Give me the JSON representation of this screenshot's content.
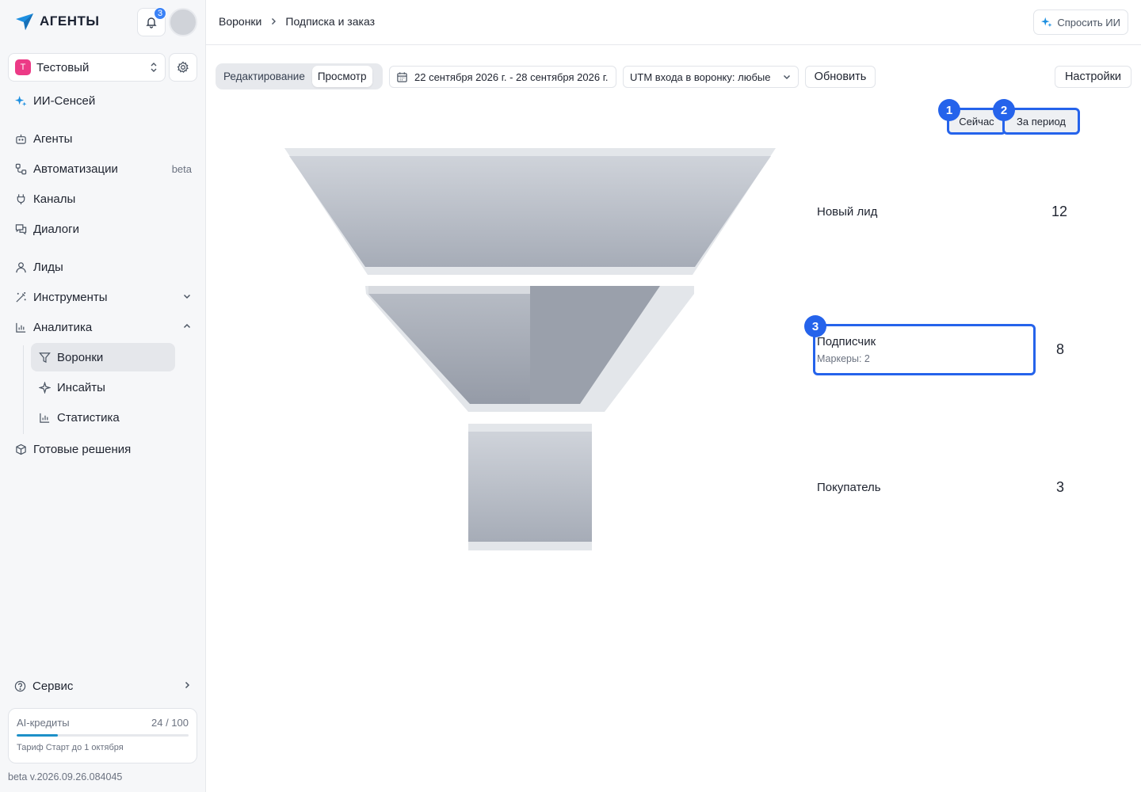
{
  "app": {
    "logo_text": "АГЕНТЫ",
    "notification_count": "3"
  },
  "workspace": {
    "badge": "Т",
    "name": "Тестовый"
  },
  "nav": {
    "ai_sensei": "ИИ-Сенсей",
    "agents": "Агенты",
    "automations": "Автоматизации",
    "automations_badge": "beta",
    "channels": "Каналы",
    "dialogs": "Диалоги",
    "leads": "Лиды",
    "tools": "Инструменты",
    "analytics": "Аналитика",
    "funnels": "Воронки",
    "insights": "Инсайты",
    "statistics": "Статистика",
    "solutions": "Готовые решения",
    "service": "Сервис"
  },
  "credits": {
    "label": "AI-кредиты",
    "value": "24 / 100",
    "used_fraction": 0.24,
    "plan": "Тариф Старт до 1 октября"
  },
  "version": "beta v.2026.09.26.084045",
  "breadcrumb": {
    "root": "Воронки",
    "current": "Подписка и заказ"
  },
  "ask_ai": "Спросить ИИ",
  "toolbar": {
    "edit": "Редактирование",
    "view": "Просмотр",
    "date_range": "22 сентября 2026 г. - 28 сентября 2026 г.",
    "utm": "UTM входа в воронку: любые",
    "refresh": "Обновить",
    "settings": "Настройки"
  },
  "toggle": {
    "now": "Сейчас",
    "period": "За период"
  },
  "markers": {
    "m1": "1",
    "m2": "2",
    "m3": "3"
  },
  "stages": [
    {
      "name": "Новый лид",
      "count": "12"
    },
    {
      "name": "Подписчик",
      "count": "8",
      "sub": "Маркеры: 2"
    },
    {
      "name": "Покупатель",
      "count": "3"
    }
  ],
  "colors": {
    "accent": "#2563eb",
    "brand_pink": "#ec3a86",
    "credits_bar": "#1d90c8"
  }
}
